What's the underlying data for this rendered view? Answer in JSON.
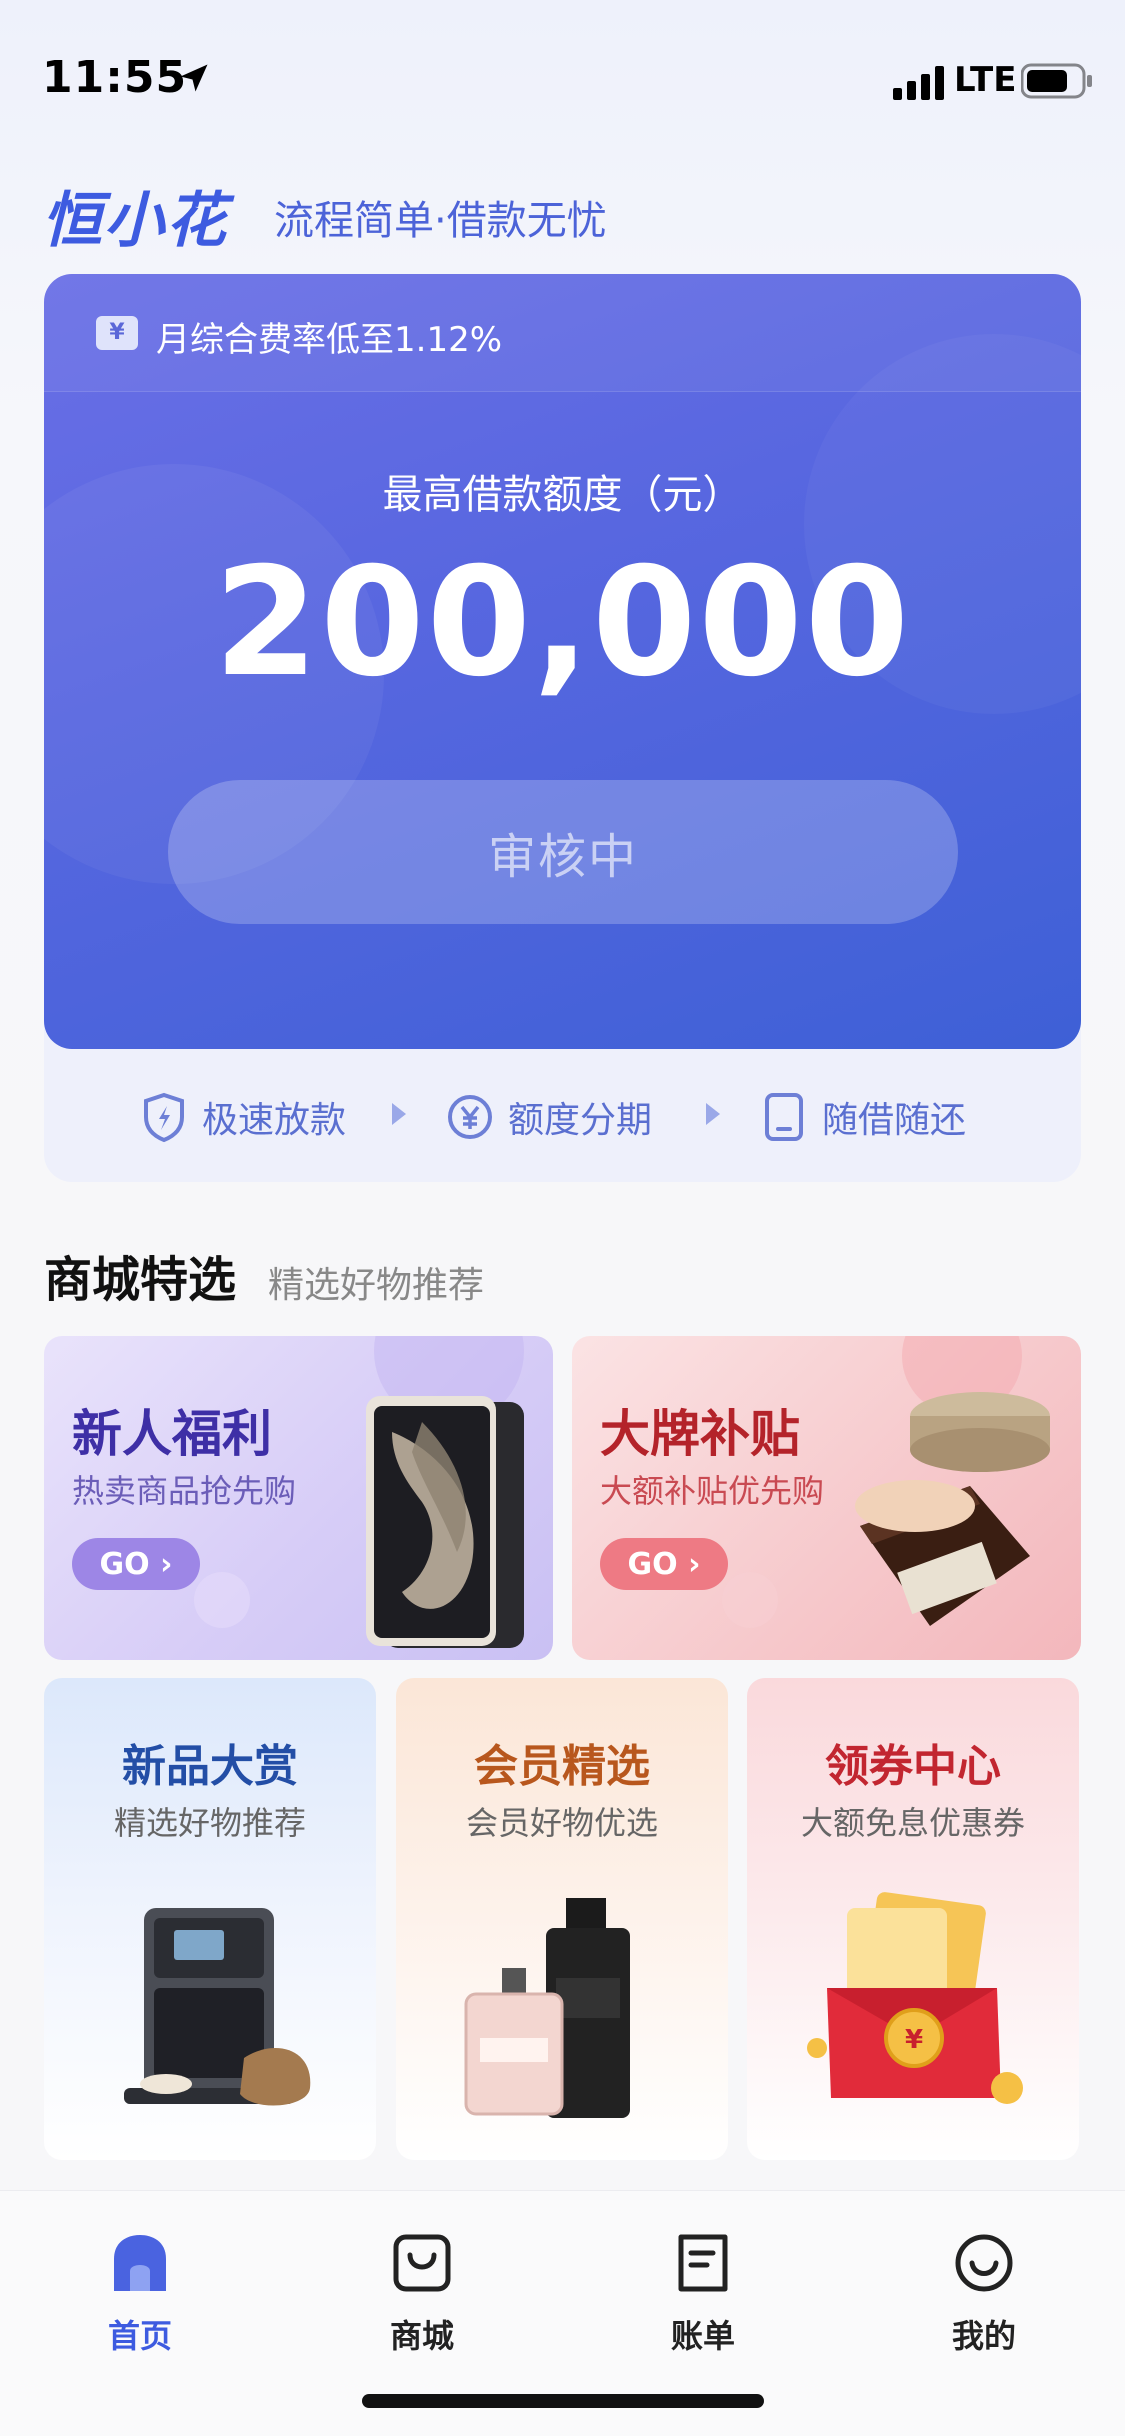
{
  "status_bar": {
    "time": "11:55",
    "network": "LTE"
  },
  "brand": {
    "logo_text": "恒小花",
    "slogan": "流程简单·借款无忧",
    "accent_color": "#3d5be0"
  },
  "hero": {
    "rate_note": "月综合费率低至1.12%",
    "limit_label": "最高借款额度（元）",
    "limit_amount": "200,000",
    "status_button": "审核中",
    "features": [
      {
        "label": "极速放款",
        "icon": "shield-icon"
      },
      {
        "label": "额度分期",
        "icon": "yuan-circle-icon"
      },
      {
        "label": "随借随还",
        "icon": "phone-icon"
      }
    ]
  },
  "mall_section": {
    "title": "商城特选",
    "subtitle": "精选好物推荐"
  },
  "promos": [
    {
      "title": "新人福利",
      "subtitle": "热卖商品抢先购",
      "button": "GO"
    },
    {
      "title": "大牌补贴",
      "subtitle": "大额补贴优先购",
      "button": "GO"
    }
  ],
  "cards": [
    {
      "title": "新品大赏",
      "subtitle": "精选好物推荐"
    },
    {
      "title": "会员精选",
      "subtitle": "会员好物优选"
    },
    {
      "title": "领券中心",
      "subtitle": "大额免息优惠券"
    }
  ],
  "tab_bar": {
    "items": [
      {
        "label": "首页",
        "icon": "home-icon",
        "active": true
      },
      {
        "label": "商城",
        "icon": "shopping-bag-icon",
        "active": false
      },
      {
        "label": "账单",
        "icon": "bill-icon",
        "active": false
      },
      {
        "label": "我的",
        "icon": "smiley-icon",
        "active": false
      }
    ]
  }
}
